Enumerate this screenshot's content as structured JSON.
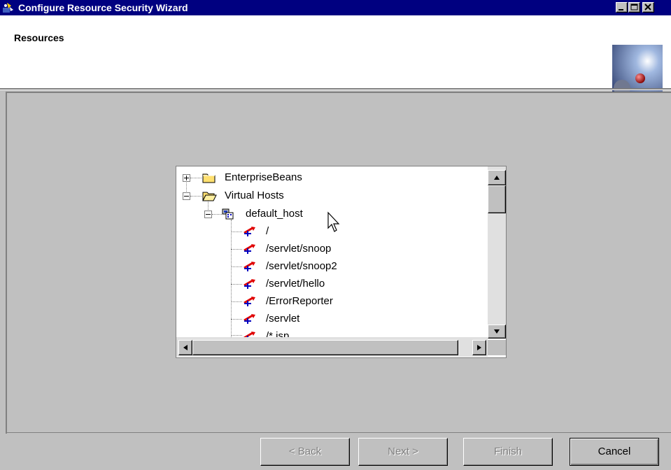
{
  "window": {
    "title": "Configure Resource Security Wizard",
    "title_icon": "wizard-app-icon",
    "controls": [
      "minimize",
      "maximize",
      "close"
    ]
  },
  "header": {
    "title": "Resources",
    "graphic": "globe-graphic"
  },
  "tree": {
    "nodes": [
      {
        "label": "EnterpriseBeans",
        "icon": "folder-icon",
        "expanded": false
      },
      {
        "label": "Virtual Hosts",
        "icon": "folder-open-icon",
        "expanded": true
      },
      {
        "label": "default_host",
        "icon": "host-icon",
        "expanded": true
      },
      {
        "label": "/",
        "icon": "uri-icon"
      },
      {
        "label": "/servlet/snoop",
        "icon": "uri-icon"
      },
      {
        "label": "/servlet/snoop2",
        "icon": "uri-icon"
      },
      {
        "label": "/servlet/hello",
        "icon": "uri-icon"
      },
      {
        "label": "/ErrorReporter",
        "icon": "uri-icon"
      },
      {
        "label": "/servlet",
        "icon": "uri-icon"
      },
      {
        "label": "/*.jsp",
        "icon": "uri-icon"
      }
    ]
  },
  "footer": {
    "back_label": "< Back",
    "next_label": "Next >",
    "finish_label": "Finish",
    "cancel_label": "Cancel"
  },
  "colors": {
    "titlebar": "#000080",
    "face": "#c0c0c0",
    "uri_arrow": "#e00000",
    "uri_pin": "#0000c0"
  }
}
